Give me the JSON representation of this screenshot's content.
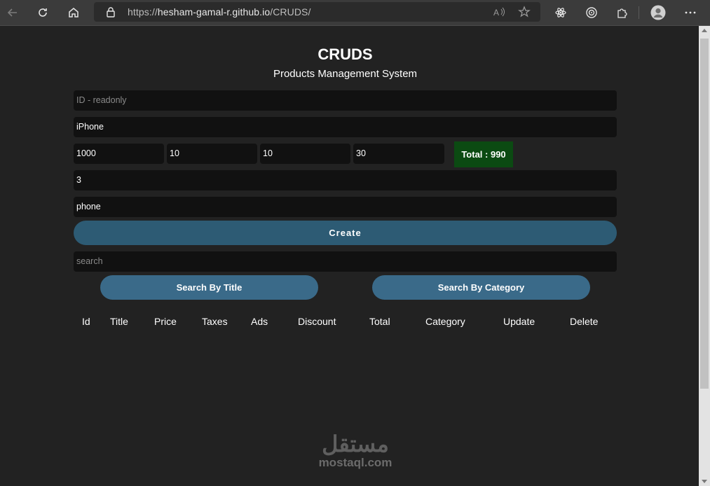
{
  "browser": {
    "url_scheme": "https://",
    "url_host": "hesham-gamal-r.github.io",
    "url_path": "/CRUDS/"
  },
  "header": {
    "title": "CRUDS",
    "subtitle": "Products Management System"
  },
  "form": {
    "id_placeholder": "ID - readonly",
    "title_value": "iPhone",
    "price_value": "1000",
    "taxes_value": "10",
    "ads_value": "10",
    "discount_value": "30",
    "total_label": "Total : 990",
    "count_value": "3",
    "category_value": "phone",
    "create_label": "Create"
  },
  "search": {
    "placeholder": "search",
    "by_title_label": "Search By Title",
    "by_category_label": "Search By Category"
  },
  "table": {
    "headers": [
      "Id",
      "Title",
      "Price",
      "Taxes",
      "Ads",
      "Discount",
      "Total",
      "Category",
      "Update",
      "Delete"
    ]
  },
  "watermark": {
    "arabic": "مستقل",
    "latin": "mostaql.com"
  },
  "colors": {
    "page_bg": "#222222",
    "input_bg": "#111111",
    "button_bg": "#2d5b74",
    "total_bg": "#0b4a12"
  }
}
